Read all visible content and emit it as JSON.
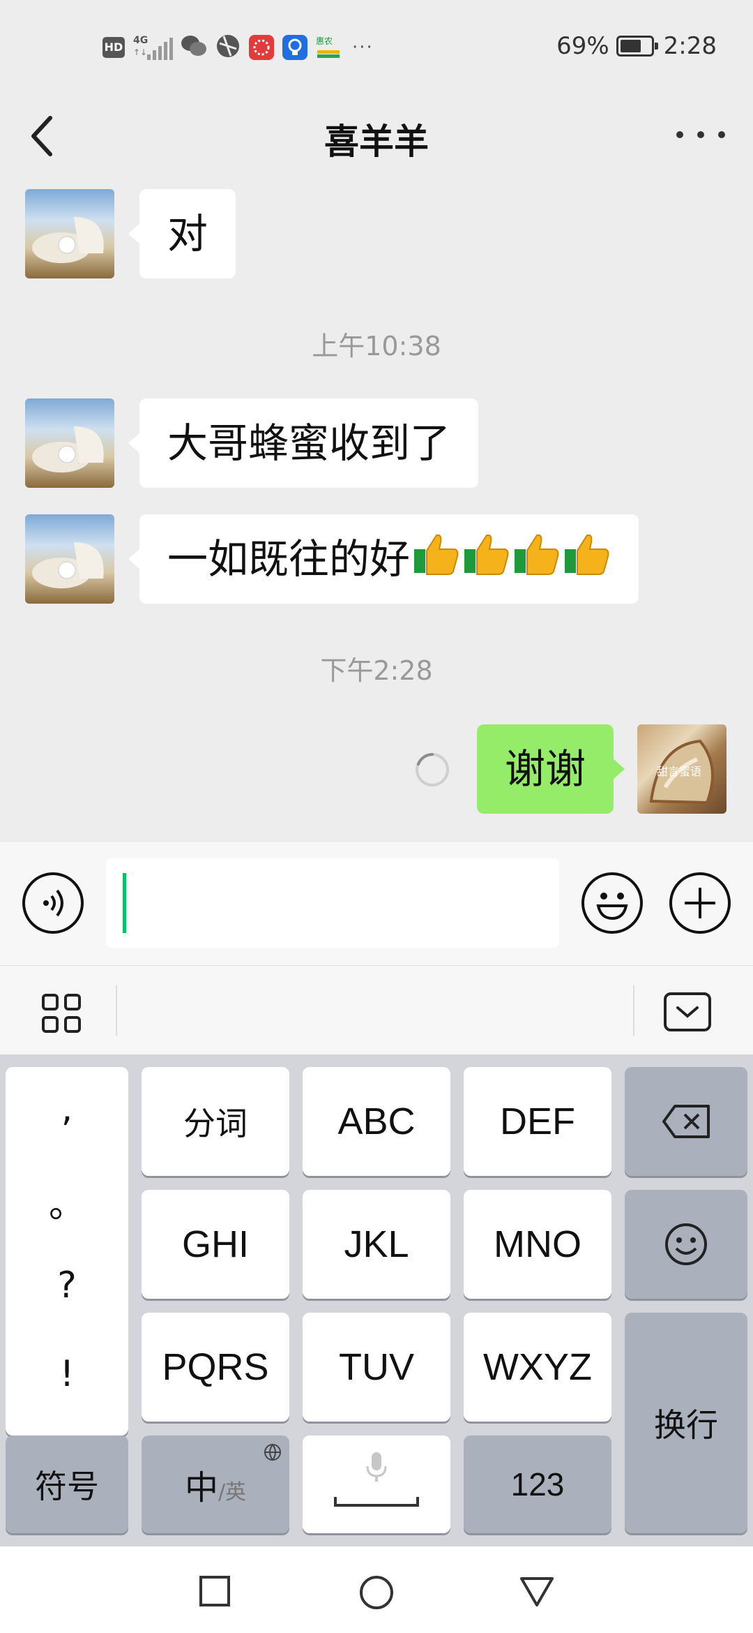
{
  "status_bar": {
    "battery_percent_text": "69%",
    "battery_level": 0.69,
    "time": "2:28",
    "network": "4G",
    "hd_badge": "HD",
    "app_badge_huinong": "惠农",
    "overflow": "···"
  },
  "nav": {
    "title": "喜羊羊"
  },
  "chat": {
    "messages": [
      {
        "side": "in",
        "text": "对"
      },
      {
        "side": "time",
        "text": "上午10:38"
      },
      {
        "side": "in",
        "text": "大哥蜂蜜收到了"
      },
      {
        "side": "in",
        "text": "一如既往的好"
      },
      {
        "side": "time",
        "text": "下午2:28"
      },
      {
        "side": "out",
        "text": "谢谢"
      }
    ],
    "my_avatar_caption": "甜言蜜语"
  },
  "keyboard": {
    "punct": [
      ",",
      "。",
      "?",
      "!"
    ],
    "row1": [
      "分词",
      "ABC",
      "DEF"
    ],
    "row2": [
      "GHI",
      "JKL",
      "MNO"
    ],
    "row3": [
      "PQRS",
      "TUV",
      "WXYZ"
    ],
    "symbols_key": "符号",
    "lang_main": "中",
    "lang_sub": "/英",
    "numbers_key": "123",
    "enter_key": "换行"
  },
  "colors": {
    "accent_green": "#07c160",
    "bubble_out": "#95ec69",
    "bubble_in": "#ffffff",
    "chat_bg": "#ededed"
  },
  "icons": {
    "back": "chevron-left-icon",
    "more": "more-dots-icon",
    "voice": "voice-icon",
    "emoji": "emoji-face-icon",
    "plus": "plus-icon",
    "grid": "grid-icon",
    "collapse": "keyboard-collapse-icon",
    "backspace": "backspace-icon",
    "thumbs_up": "thumbs-up-icon"
  }
}
